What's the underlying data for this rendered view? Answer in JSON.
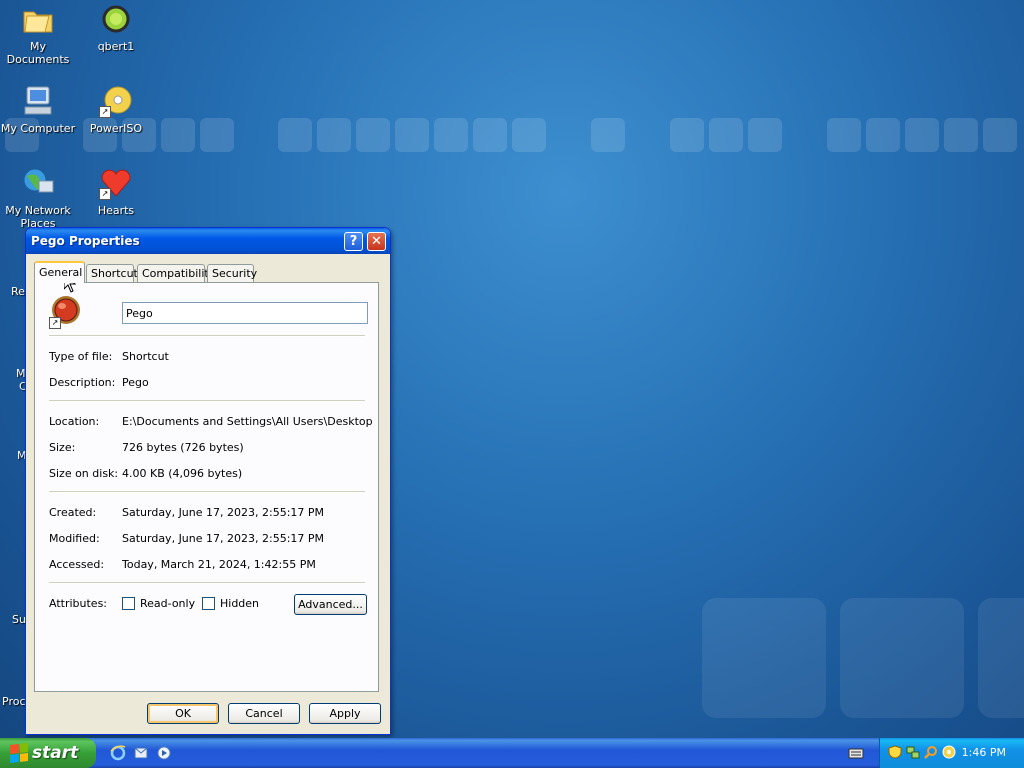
{
  "desktop": {
    "icons": [
      {
        "label": "My Documents"
      },
      {
        "label": "qbert1"
      },
      {
        "label": "My Computer"
      },
      {
        "label": "PowerISO"
      },
      {
        "label": "My Network Places"
      },
      {
        "label": "Hearts"
      }
    ],
    "edge_labels": [
      "Re",
      "M",
      "C",
      "M",
      "Su",
      "Proc"
    ]
  },
  "dialog": {
    "title": "Pego Properties",
    "help_label": "?",
    "close_label": "✕",
    "tabs": [
      "General",
      "Shortcut",
      "Compatibility",
      "Security"
    ],
    "active_tab": "General",
    "name_value": "Pego",
    "fields": {
      "type_label": "Type of file:",
      "type_value": "Shortcut",
      "desc_label": "Description:",
      "desc_value": "Pego",
      "location_label": "Location:",
      "location_value": "E:\\Documents and Settings\\All Users\\Desktop",
      "size_label": "Size:",
      "size_value": "726 bytes (726 bytes)",
      "disk_label": "Size on disk:",
      "disk_value": "4.00 KB (4,096 bytes)",
      "created_label": "Created:",
      "created_value": "Saturday, June 17, 2023, 2:55:17 PM",
      "modified_label": "Modified:",
      "modified_value": "Saturday, June 17, 2023, 2:55:17 PM",
      "accessed_label": "Accessed:",
      "accessed_value": "Today, March 21, 2024, 1:42:55 PM",
      "attributes_label": "Attributes:"
    },
    "readonly_label": "Read-only",
    "hidden_label": "Hidden",
    "advanced_label": "Advanced...",
    "ok_label": "OK",
    "cancel_label": "Cancel",
    "apply_label": "Apply"
  },
  "taskbar": {
    "start_label": "start",
    "clock": "1:46 PM"
  },
  "colors": {
    "titlebar": "#0058e6",
    "taskbar": "#245edb",
    "start_button": "#379f37",
    "tray": "#1290e8"
  }
}
